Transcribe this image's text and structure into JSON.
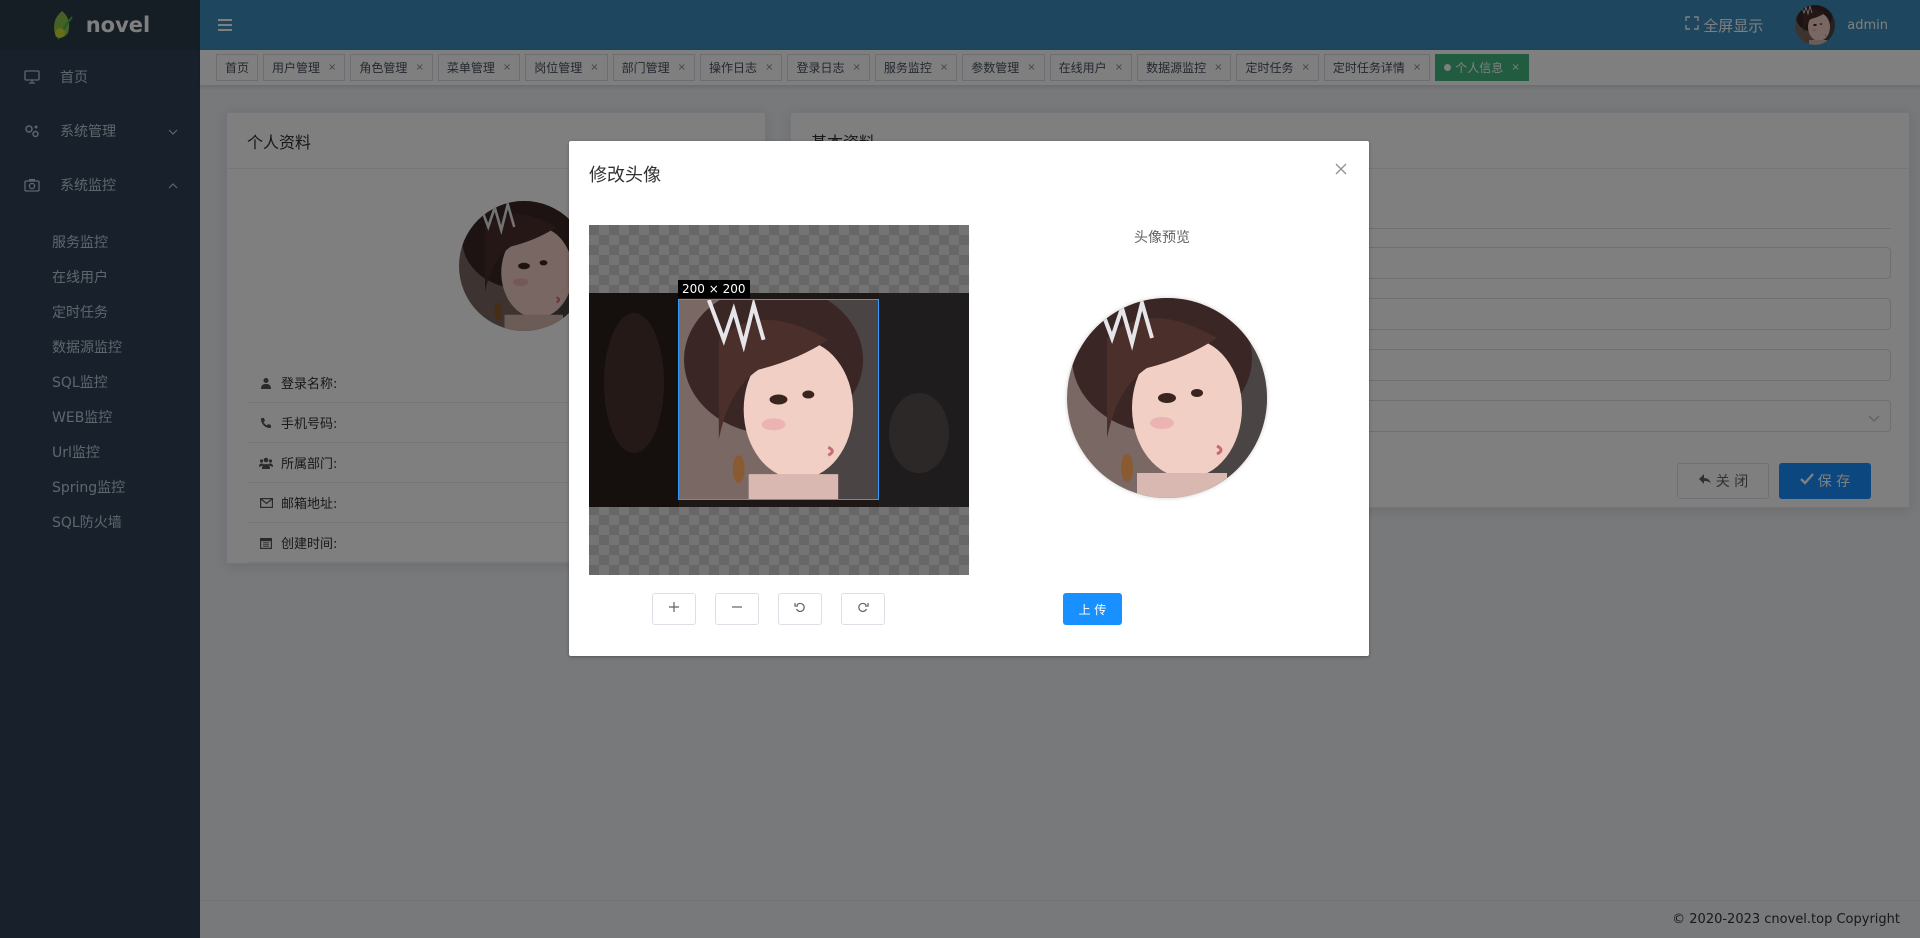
{
  "app": {
    "logo_text": "novel"
  },
  "header": {
    "fullscreen_label": "全屏显示",
    "username": "admin"
  },
  "sidebar": {
    "items": [
      {
        "label": "首页",
        "icon": "monitor-icon"
      },
      {
        "label": "系统管理",
        "icon": "gears-icon"
      },
      {
        "label": "系统监控",
        "icon": "camera-icon"
      }
    ],
    "subitems": [
      "服务监控",
      "在线用户",
      "定时任务",
      "数据源监控",
      "SQL监控",
      "WEB监控",
      "Url监控",
      "Spring监控",
      "SQL防火墙"
    ]
  },
  "tags": [
    {
      "label": "首页",
      "closable": false
    },
    {
      "label": "用户管理",
      "closable": true
    },
    {
      "label": "角色管理",
      "closable": true
    },
    {
      "label": "菜单管理",
      "closable": true
    },
    {
      "label": "岗位管理",
      "closable": true
    },
    {
      "label": "部门管理",
      "closable": true
    },
    {
      "label": "操作日志",
      "closable": true
    },
    {
      "label": "登录日志",
      "closable": true
    },
    {
      "label": "服务监控",
      "closable": true
    },
    {
      "label": "参数管理",
      "closable": true
    },
    {
      "label": "在线用户",
      "closable": true
    },
    {
      "label": "数据源监控",
      "closable": true
    },
    {
      "label": "定时任务",
      "closable": true
    },
    {
      "label": "定时任务详情",
      "closable": true
    },
    {
      "label": "个人信息",
      "closable": true,
      "active": true
    }
  ],
  "profile": {
    "title": "个人资料",
    "rows": [
      {
        "label": "登录名称:",
        "icon": "user-icon"
      },
      {
        "label": "手机号码:",
        "icon": "phone-icon"
      },
      {
        "label": "所属部门:",
        "icon": "users-icon"
      },
      {
        "label": "邮箱地址:",
        "icon": "envelope-icon"
      },
      {
        "label": "创建时间:",
        "icon": "calendar-icon"
      }
    ]
  },
  "basic": {
    "title": "基本资料",
    "close_label": "关 闭",
    "save_label": "保 存"
  },
  "dialog": {
    "title": "修改头像",
    "crop_size": "200 × 200",
    "preview_title": "头像预览",
    "upload_label": "上 传",
    "controls": [
      "plus-icon",
      "minus-icon",
      "rotate-left-icon",
      "rotate-right-icon"
    ]
  },
  "footer": {
    "copyright": "© 2020-2023 cnovel.top Copyright"
  },
  "colors": {
    "header": "#3c8dbc",
    "sidebar": "#304156",
    "active_tag": "#42b983",
    "primary": "#1890ff"
  }
}
